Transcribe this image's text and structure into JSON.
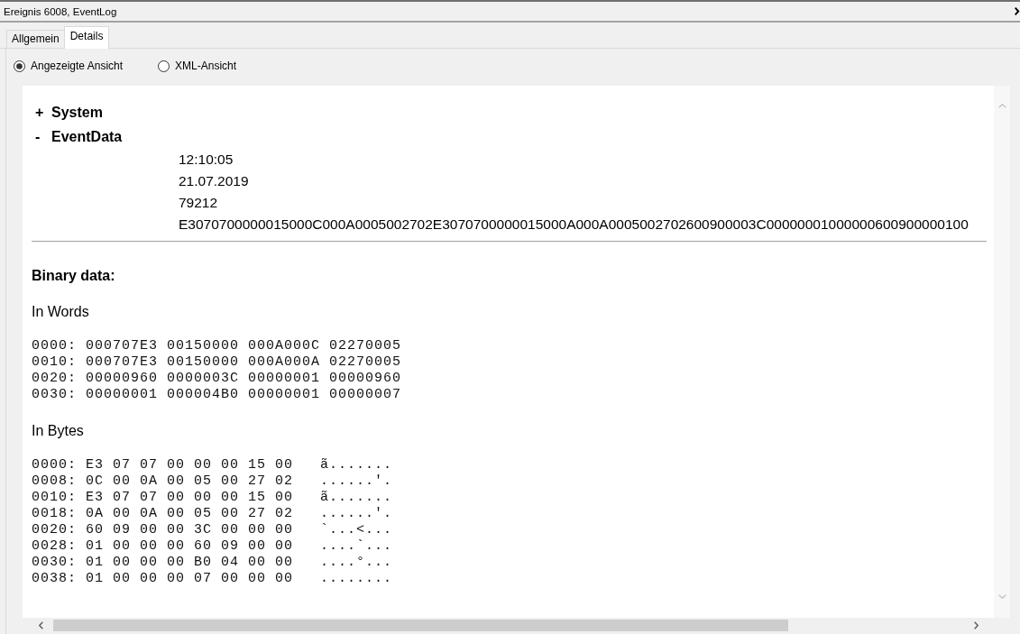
{
  "window": {
    "title": "Ereignis 6008, EventLog"
  },
  "tabs": [
    {
      "label": "Allgemein",
      "selected": false
    },
    {
      "label": "Details",
      "selected": true
    }
  ],
  "view_options": [
    {
      "label": "Angezeigte Ansicht",
      "selected": true
    },
    {
      "label": "XML-Ansicht",
      "selected": false
    }
  ],
  "details": {
    "tree": [
      {
        "toggle": "+",
        "label": "System"
      },
      {
        "toggle": "-",
        "label": "EventData",
        "values": [
          "12:10:05",
          "21.07.2019",
          "79212",
          "E3070700000015000C000A0005002702E3070700000015000A000A0005002702600900003C00000001000000600900000100"
        ]
      }
    ],
    "binary_heading": "Binary data:",
    "words": {
      "heading": "In Words",
      "lines": [
        "0000: 000707E3 00150000 000A000C 02270005",
        "0010: 000707E3 00150000 000A000A 02270005",
        "0020: 00000960 0000003C 00000001 00000960",
        "0030: 00000001 000004B0 00000001 00000007"
      ]
    },
    "bytes": {
      "heading": "In Bytes",
      "lines": [
        "0000: E3 07 07 00 00 00 15 00   ã.......",
        "0008: 0C 00 0A 00 05 00 27 02   ......'.",
        "0010: E3 07 07 00 00 00 15 00   ã.......",
        "0018: 0A 00 0A 00 05 00 27 02   ......'.",
        "0020: 60 09 00 00 3C 00 00 00   `...<...",
        "0028: 01 00 00 00 60 09 00 00   ....`...",
        "0030: 01 00 00 00 B0 04 00 00   ....°...",
        "0038: 01 00 00 00 07 00 00 00   ........"
      ]
    }
  }
}
